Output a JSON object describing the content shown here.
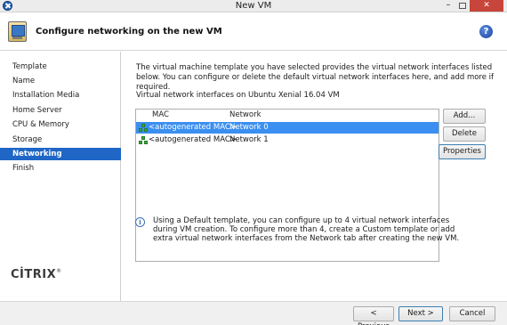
{
  "window": {
    "title": "New VM",
    "minimize": "–",
    "close": "✕"
  },
  "header": {
    "title": "Configure networking on the new VM",
    "help": "?"
  },
  "sidebar": {
    "items": [
      {
        "label": "Template"
      },
      {
        "label": "Name"
      },
      {
        "label": "Installation Media"
      },
      {
        "label": "Home Server"
      },
      {
        "label": "CPU & Memory"
      },
      {
        "label": "Storage"
      },
      {
        "label": "Networking",
        "active": true
      },
      {
        "label": "Finish"
      }
    ],
    "logo": "CİTRIX",
    "logo_mark": "®"
  },
  "main": {
    "intro": "The virtual machine template you have selected provides the virtual network interfaces listed below. You can configure or delete the default virtual network interfaces here, and add more if required.",
    "list_caption": "Virtual network interfaces on Ubuntu Xenial 16.04 VM",
    "columns": {
      "mac": "MAC",
      "network": "Network"
    },
    "rows": [
      {
        "mac": "<autogenerated MAC>",
        "network": "Network 0",
        "selected": true
      },
      {
        "mac": "<autogenerated MAC>",
        "network": "Network 1",
        "selected": false
      }
    ],
    "buttons": {
      "add": "Add...",
      "delete": "Delete",
      "properties": "Properties"
    },
    "info_icon": "i",
    "info": "Using a Default template, you can configure up to 4 virtual network interfaces during VM creation. To configure more than 4, create a Custom template or add extra virtual network interfaces from the Network tab after creating the new VM."
  },
  "footer": {
    "previous": "< Previous",
    "next": "Next >",
    "cancel": "Cancel"
  },
  "colors": {
    "selection": "#1f66c6",
    "row_selected": "#3b8ff0",
    "close_button": "#c7453a"
  }
}
